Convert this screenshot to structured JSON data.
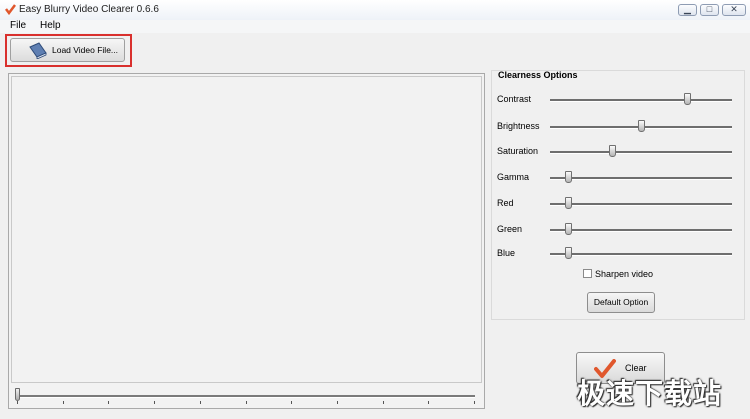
{
  "window": {
    "title": "Easy Blurry Video Clearer 0.6.6"
  },
  "menu": {
    "items": [
      "File",
      "Help"
    ]
  },
  "toolbar": {
    "load_label": "Load Video File..."
  },
  "options": {
    "title": "Clearness Options",
    "sliders": [
      {
        "label": "Contrast",
        "value": 0.75
      },
      {
        "label": "Brightness",
        "value": 0.5
      },
      {
        "label": "Saturation",
        "value": 0.34
      },
      {
        "label": "Gamma",
        "value": 0.1
      },
      {
        "label": "Red",
        "value": 0.1
      },
      {
        "label": "Green",
        "value": 0.1
      },
      {
        "label": "Blue",
        "value": 0.1
      }
    ],
    "sharpen_label": "Sharpen video",
    "sharpen_checked": false,
    "default_label": "Default Option"
  },
  "seek": {
    "position": 0
  },
  "clear_label": "Clear",
  "watermark": "极速下载站",
  "colors": {
    "highlight": "#d9302d",
    "accent": "#e0572d"
  }
}
